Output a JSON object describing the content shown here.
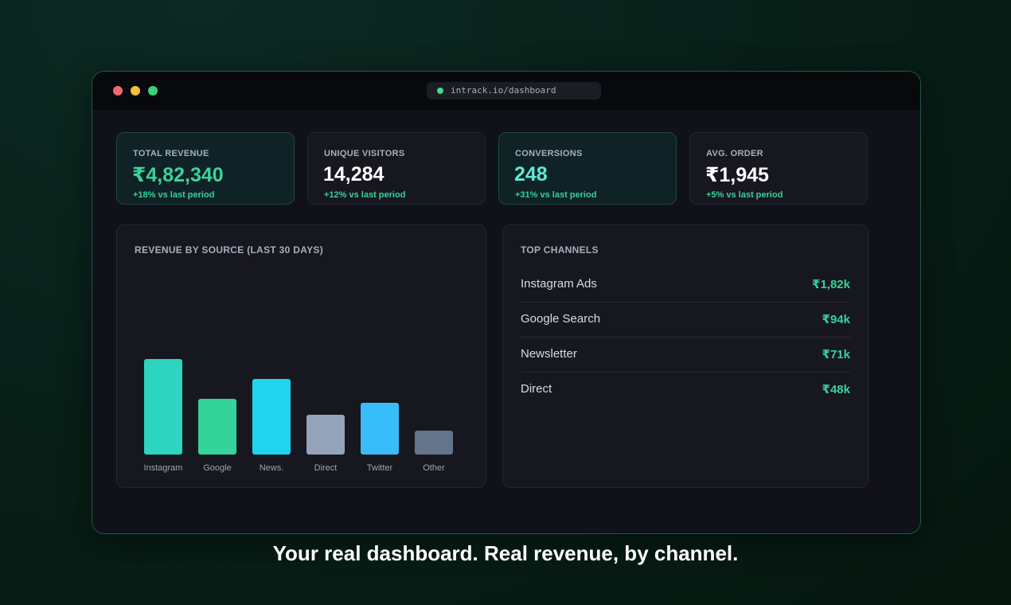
{
  "window": {
    "url": "intrack.io/dashboard"
  },
  "stats": [
    {
      "label": "TOTAL REVENUE",
      "value": "₹4,82,340",
      "change": "+18% vs last period"
    },
    {
      "label": "UNIQUE VISITORS",
      "value": "14,284",
      "change": "+12% vs last period"
    },
    {
      "label": "CONVERSIONS",
      "value": "248",
      "change": "+31% vs last period"
    },
    {
      "label": "AVG. ORDER",
      "value": "₹1,945",
      "change": "+5% vs last period"
    }
  ],
  "revenue_panel": {
    "title": "REVENUE BY SOURCE (LAST 30 DAYS)"
  },
  "chart_data": {
    "type": "bar",
    "title": "REVENUE BY SOURCE (LAST 30 DAYS)",
    "categories": [
      "Instagram",
      "Google",
      "News.",
      "Direct",
      "Twitter",
      "Other"
    ],
    "values": [
      120,
      70,
      95,
      50,
      65,
      30
    ],
    "colors": [
      "#2dd4bf",
      "#34d399",
      "#22d3ee",
      "#94a3b8",
      "#38bdf8",
      "#64748b"
    ],
    "xlabel": "",
    "ylabel": "",
    "grid": false
  },
  "channels_panel": {
    "title": "TOP CHANNELS",
    "items": [
      {
        "name": "Instagram Ads",
        "value": "₹1,82k"
      },
      {
        "name": "Google Search",
        "value": "₹94k"
      },
      {
        "name": "Newsletter",
        "value": "₹71k"
      },
      {
        "name": "Direct",
        "value": "₹48k"
      }
    ]
  },
  "caption": "Your real dashboard. Real revenue, by channel."
}
